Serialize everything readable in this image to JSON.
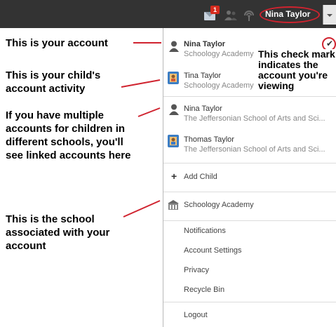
{
  "topbar": {
    "notification_badge": "1",
    "user_name": "Nina Taylor",
    "icons": [
      "mail-icon",
      "people-icon",
      "signal-icon",
      "chevron-down-icon"
    ],
    "highlight_color": "#d0232f"
  },
  "dropdown": {
    "accounts": [
      {
        "name": "Nina Taylor",
        "school": "Schoology Academy",
        "icon": "person-icon",
        "active": true
      },
      {
        "name": "Tina Taylor",
        "school": "Schoology Academy",
        "icon": "child-profile-icon",
        "active": false
      },
      {
        "name": "Nina Taylor",
        "school": "The Jeffersonian School of Arts and Sci...",
        "icon": "person-icon",
        "active": false
      },
      {
        "name": "Thomas Taylor",
        "school": "The Jeffersonian School of Arts and Sci...",
        "icon": "child-profile-icon",
        "active": false
      }
    ],
    "add_child": "Add Child",
    "school": "Schoology Academy",
    "menu": [
      "Notifications",
      "Account Settings",
      "Privacy",
      "Recycle Bin"
    ],
    "logout": "Logout"
  },
  "annotations": {
    "account": "This is your account",
    "child_activity": "This is your child's account activity",
    "linked_accounts": "If you have multiple accounts for children in different schools, you'll see linked accounts here",
    "school": "This is the school associated with your account",
    "check_mark": "This check mark indicates the account you're viewing"
  }
}
